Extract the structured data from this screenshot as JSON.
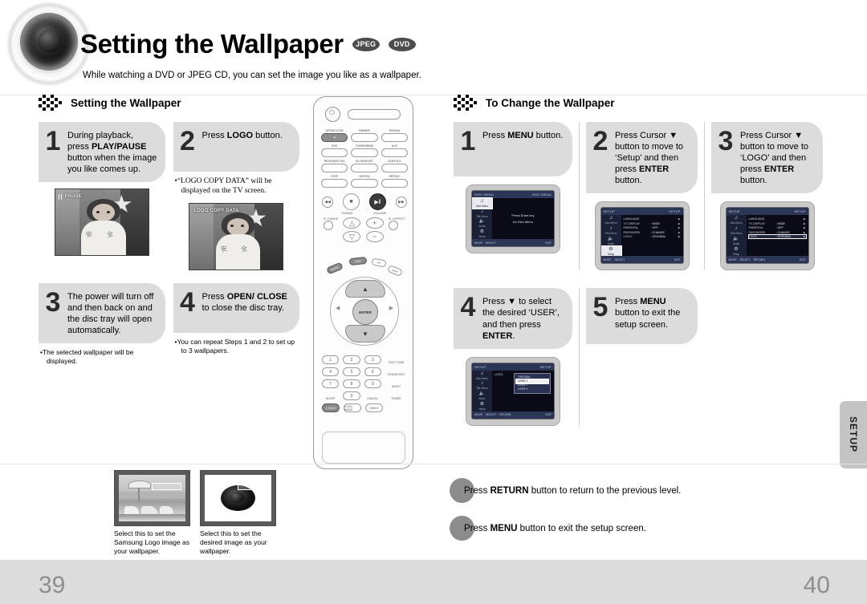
{
  "header": {
    "title": "Setting the Wallpaper",
    "badges": [
      "JPEG",
      "DVD"
    ],
    "subtitle": "While watching a DVD or JPEG CD, you can set the image you like as a wallpaper."
  },
  "left_section": {
    "heading": "Setting the Wallpaper",
    "steps": [
      {
        "number": "1",
        "text_parts": [
          "During playback, press ",
          "PLAY/PAUSE",
          " button when the image you like comes up."
        ],
        "bullet": "",
        "screen_osd": "PAUSE"
      },
      {
        "number": "2",
        "text_parts": [
          "Press ",
          "LOGO",
          " button."
        ],
        "bullet": "“LOGO COPY DATA” will be displayed on the TV screen.",
        "screen_osd": "LOGO COPY DATA"
      },
      {
        "number": "3",
        "text_parts": [
          "The power will turn off and then back on and the disc tray will open automatically."
        ],
        "bullet": "The selected wallpaper will be displayed."
      },
      {
        "number": "4",
        "text_parts": [
          "Press ",
          "OPEN/ CLOSE",
          " to close the disc tray."
        ],
        "bullet": "You can repeat Steps 1 and 2 to set up to 3 wallpapers."
      }
    ]
  },
  "right_section": {
    "heading": "To Change the Wallpaper",
    "steps": [
      {
        "number": "1",
        "text_parts": [
          "Press ",
          "MENU",
          " button."
        ]
      },
      {
        "number": "2",
        "text_parts": [
          "Press Cursor ▼ button to move to ‘Setup’ and then press ",
          "ENTER",
          " button."
        ]
      },
      {
        "number": "3",
        "text_parts": [
          "Press Cursor ▼ button to move to ‘LOGO’ and then press ",
          "ENTER",
          " button."
        ]
      },
      {
        "number": "4",
        "text_parts": [
          "Press ▼ to select the desired ‘USER’, and then press ",
          "ENTER",
          "."
        ]
      },
      {
        "number": "5",
        "text_parts": [
          "Press ",
          "MENU",
          " button to exit the setup screen."
        ]
      }
    ]
  },
  "tv_screens": {
    "disc_menu": {
      "bar_left": "DISC MENU",
      "bar_right": "DISC MENU",
      "side_items": [
        "Disc Menu",
        "Title Menu",
        "Audio",
        "Setup"
      ],
      "selected_side": 0,
      "center_lines": [
        "Press Enter key",
        "for Disc Menu"
      ],
      "footer": [
        "MOVE",
        "SELECT",
        "EXIT"
      ]
    },
    "setup_menu": {
      "bar_left": "SETUP",
      "bar_right": "SETUP",
      "side_items": [
        "Disc Menu",
        "Title Menu",
        "Audio",
        "Setup"
      ],
      "selected_side": 3,
      "rows": [
        {
          "name": "LANGUAGE",
          "value": ""
        },
        {
          "name": "TV DISPLAY",
          "value": ": WIDE"
        },
        {
          "name": "PARENTAL",
          "value": ": OFF"
        },
        {
          "name": "PASSWORD",
          "value": ": CHANGE"
        },
        {
          "name": "LOGO",
          "value": ": ORIGINAL"
        }
      ],
      "highlight_row": -1,
      "footer": [
        "MOVE",
        "SELECT",
        "EXIT"
      ]
    },
    "logo_row_selected": {
      "bar_left": "SETUP",
      "bar_right": "SETUP",
      "side_items": [
        "Disc Menu",
        "Title Menu",
        "Audio",
        "Setup"
      ],
      "selected_side": 3,
      "rows": [
        {
          "name": "LANGUAGE",
          "value": ""
        },
        {
          "name": "TV DISPLAY",
          "value": ": WIDE"
        },
        {
          "name": "PARENTAL",
          "value": ": OFF"
        },
        {
          "name": "PASSWORD",
          "value": ": CHANGE"
        },
        {
          "name": "LOGO",
          "value": ": ORIGINAL"
        }
      ],
      "highlight_row": 4,
      "footer": [
        "MOVE",
        "SELECT",
        "RETURN",
        "EXIT"
      ]
    },
    "logo_submenu": {
      "bar_left": "SETUP",
      "bar_right": "SETUP",
      "side_items": [
        "Disc Menu",
        "Title Menu",
        "Audio",
        "Setup"
      ],
      "selected_side": 3,
      "label": "LOGO",
      "options": [
        "ORIGINAL",
        "USER 1",
        "USER 2",
        "USER 3"
      ],
      "selected_option": 1,
      "footer": [
        "MOVE",
        "SELECT",
        "RETURN",
        "EXIT"
      ]
    }
  },
  "remote": {
    "label": "remote-control",
    "rows": [
      [
        "OPEN/CLOSE",
        "DIMMER",
        "REMAIN"
      ],
      [
        "DVD",
        "TUNER/BAND",
        "AUX"
      ],
      [
        "REVIEW/NT-PAL",
        "SLOW/MO/ST",
        "SUBTITLE"
      ],
      [
        "STEP",
        "DSP/EQ",
        "REPEAT"
      ]
    ],
    "transport": [
      "◀◀",
      "■",
      "▶‖",
      "▶▶"
    ],
    "tuning_label": "TUNING",
    "volume_label": "VOLUME",
    "plii_mode": "PL II MODE",
    "plii_effect": "PL II EFFECT",
    "enter_label": "ENTER",
    "keypad": [
      "1",
      "2",
      "3",
      "4",
      "5",
      "6",
      "7",
      "8",
      "9",
      "0"
    ],
    "keypad_side": [
      "TEST TONE",
      "SOUND EDIT",
      "MO/ST"
    ],
    "keypad_extra": [
      "SLEEP",
      "CANCEL",
      "TUNER"
    ],
    "bottom_keys": [
      "LOGO",
      "S.DEC MODE",
      "VIDEO"
    ]
  },
  "bottom_thumbs": [
    {
      "caption": "Select this to set the Samsung Logo image as your wallpaper."
    },
    {
      "caption": "Select this to set the desired image as your wallpaper."
    }
  ],
  "notes": [
    {
      "parts": [
        "Press ",
        "RETURN",
        " button to return to the previous level."
      ]
    },
    {
      "parts": [
        "Press ",
        "MENU",
        " button to exit the setup screen."
      ]
    }
  ],
  "side_tab": "SETUP",
  "page_numbers": {
    "left": "39",
    "right": "40"
  },
  "colors": {
    "card": "#dcdcdc",
    "band": "#dcdcdc",
    "page_num": "#8e8e8e",
    "badge": "#4c4c4c"
  }
}
